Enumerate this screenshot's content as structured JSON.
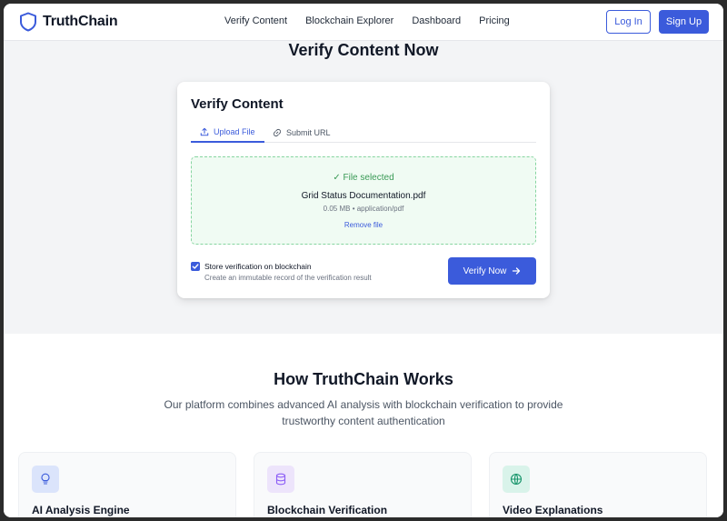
{
  "nav": {
    "brand": "TruthChain",
    "links": [
      "Verify Content",
      "Blockchain Explorer",
      "Dashboard",
      "Pricing"
    ],
    "login": "Log In",
    "signup": "Sign Up"
  },
  "hero": {
    "title": "Verify Content Now"
  },
  "card": {
    "title": "Verify Content",
    "tabs": [
      {
        "label": "Upload File",
        "icon": "upload-icon",
        "active": true
      },
      {
        "label": "Submit URL",
        "icon": "link-icon",
        "active": false
      }
    ],
    "dropzone": {
      "status": "✓ File selected",
      "file_name": "Grid Status Documentation.pdf",
      "file_meta": "0.05 MB • application/pdf",
      "remove": "Remove file"
    },
    "store_checkbox": {
      "checked": true,
      "label": "Store verification on blockchain",
      "sublabel": "Create an immutable record of the verification result"
    },
    "verify_button": "Verify Now"
  },
  "how": {
    "title": "How TruthChain Works",
    "subtitle": "Our platform combines advanced AI analysis with blockchain verification to provide trustworthy content authentication",
    "features": [
      {
        "title": "AI Analysis Engine",
        "icon": "lightbulb-icon"
      },
      {
        "title": "Blockchain Verification",
        "icon": "database-icon"
      },
      {
        "title": "Video Explanations",
        "icon": "globe-icon"
      }
    ]
  },
  "colors": {
    "accent": "#3b5bdb",
    "success": "#3a9a56"
  }
}
